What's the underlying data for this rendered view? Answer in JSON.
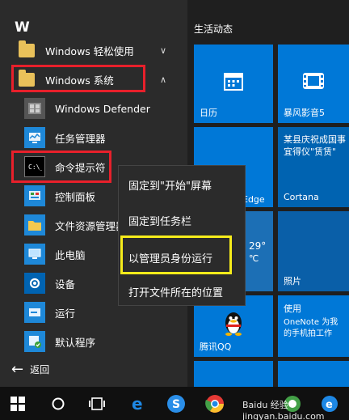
{
  "app_list": {
    "letter": "W",
    "items": [
      {
        "label": "Windows 轻松使用",
        "chevron": "∨"
      },
      {
        "label": "Windows 系统",
        "chevron": "∧"
      },
      {
        "label": "Windows Defender"
      },
      {
        "label": "任务管理器"
      },
      {
        "label": "命令提示符"
      },
      {
        "label": "控制面板"
      },
      {
        "label": "文件资源管理器"
      },
      {
        "label": "此电脑"
      },
      {
        "label": "设备"
      },
      {
        "label": "运行"
      },
      {
        "label": "默认程序"
      }
    ],
    "back_label": "返回"
  },
  "tiles": {
    "group_title": "生活动态",
    "calendar": "日历",
    "storm": "暴风影音5",
    "news": "某县庆祝成国事 宜得仪\"赁赁\"",
    "edge": "Edge",
    "cortana": "Cortana",
    "weather_temp": "29°",
    "weather_partial": "℃",
    "photos": "照片",
    "onenote_title": "使用",
    "onenote_line1": "OneNote 为我",
    "onenote_line2": "的手机拍工作",
    "qq": "腾讯QQ"
  },
  "context_menu": {
    "items": [
      "固定到\"开始\"屏幕",
      "固定到任务栏",
      "以管理员身份运行",
      "打开文件所在的位置"
    ]
  },
  "taskbar": {
    "watermark": "Baidu 经验 jingyan.baidu.com"
  },
  "colors": {
    "tile_blue": "#0078d7",
    "highlight_red": "#e8202b",
    "highlight_yellow": "#f6ec1b"
  }
}
